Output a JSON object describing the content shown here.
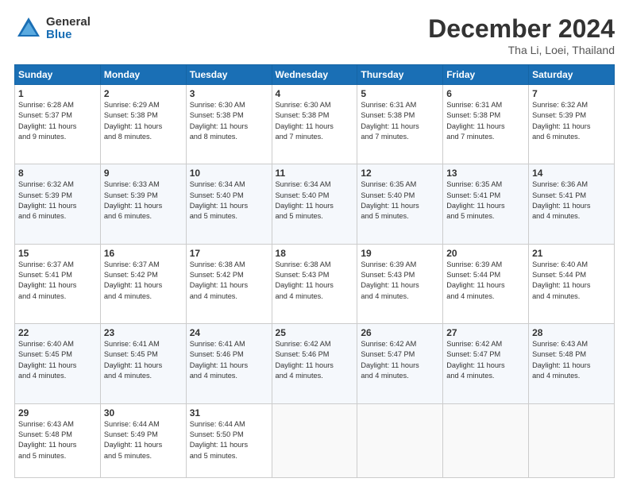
{
  "header": {
    "logo_general": "General",
    "logo_blue": "Blue",
    "month": "December 2024",
    "location": "Tha Li, Loei, Thailand"
  },
  "weekdays": [
    "Sunday",
    "Monday",
    "Tuesday",
    "Wednesday",
    "Thursday",
    "Friday",
    "Saturday"
  ],
  "weeks": [
    [
      {
        "day": "1",
        "info": "Sunrise: 6:28 AM\nSunset: 5:37 PM\nDaylight: 11 hours\nand 9 minutes."
      },
      {
        "day": "2",
        "info": "Sunrise: 6:29 AM\nSunset: 5:38 PM\nDaylight: 11 hours\nand 8 minutes."
      },
      {
        "day": "3",
        "info": "Sunrise: 6:30 AM\nSunset: 5:38 PM\nDaylight: 11 hours\nand 8 minutes."
      },
      {
        "day": "4",
        "info": "Sunrise: 6:30 AM\nSunset: 5:38 PM\nDaylight: 11 hours\nand 7 minutes."
      },
      {
        "day": "5",
        "info": "Sunrise: 6:31 AM\nSunset: 5:38 PM\nDaylight: 11 hours\nand 7 minutes."
      },
      {
        "day": "6",
        "info": "Sunrise: 6:31 AM\nSunset: 5:38 PM\nDaylight: 11 hours\nand 7 minutes."
      },
      {
        "day": "7",
        "info": "Sunrise: 6:32 AM\nSunset: 5:39 PM\nDaylight: 11 hours\nand 6 minutes."
      }
    ],
    [
      {
        "day": "8",
        "info": "Sunrise: 6:32 AM\nSunset: 5:39 PM\nDaylight: 11 hours\nand 6 minutes."
      },
      {
        "day": "9",
        "info": "Sunrise: 6:33 AM\nSunset: 5:39 PM\nDaylight: 11 hours\nand 6 minutes."
      },
      {
        "day": "10",
        "info": "Sunrise: 6:34 AM\nSunset: 5:40 PM\nDaylight: 11 hours\nand 5 minutes."
      },
      {
        "day": "11",
        "info": "Sunrise: 6:34 AM\nSunset: 5:40 PM\nDaylight: 11 hours\nand 5 minutes."
      },
      {
        "day": "12",
        "info": "Sunrise: 6:35 AM\nSunset: 5:40 PM\nDaylight: 11 hours\nand 5 minutes."
      },
      {
        "day": "13",
        "info": "Sunrise: 6:35 AM\nSunset: 5:41 PM\nDaylight: 11 hours\nand 5 minutes."
      },
      {
        "day": "14",
        "info": "Sunrise: 6:36 AM\nSunset: 5:41 PM\nDaylight: 11 hours\nand 4 minutes."
      }
    ],
    [
      {
        "day": "15",
        "info": "Sunrise: 6:37 AM\nSunset: 5:41 PM\nDaylight: 11 hours\nand 4 minutes."
      },
      {
        "day": "16",
        "info": "Sunrise: 6:37 AM\nSunset: 5:42 PM\nDaylight: 11 hours\nand 4 minutes."
      },
      {
        "day": "17",
        "info": "Sunrise: 6:38 AM\nSunset: 5:42 PM\nDaylight: 11 hours\nand 4 minutes."
      },
      {
        "day": "18",
        "info": "Sunrise: 6:38 AM\nSunset: 5:43 PM\nDaylight: 11 hours\nand 4 minutes."
      },
      {
        "day": "19",
        "info": "Sunrise: 6:39 AM\nSunset: 5:43 PM\nDaylight: 11 hours\nand 4 minutes."
      },
      {
        "day": "20",
        "info": "Sunrise: 6:39 AM\nSunset: 5:44 PM\nDaylight: 11 hours\nand 4 minutes."
      },
      {
        "day": "21",
        "info": "Sunrise: 6:40 AM\nSunset: 5:44 PM\nDaylight: 11 hours\nand 4 minutes."
      }
    ],
    [
      {
        "day": "22",
        "info": "Sunrise: 6:40 AM\nSunset: 5:45 PM\nDaylight: 11 hours\nand 4 minutes."
      },
      {
        "day": "23",
        "info": "Sunrise: 6:41 AM\nSunset: 5:45 PM\nDaylight: 11 hours\nand 4 minutes."
      },
      {
        "day": "24",
        "info": "Sunrise: 6:41 AM\nSunset: 5:46 PM\nDaylight: 11 hours\nand 4 minutes."
      },
      {
        "day": "25",
        "info": "Sunrise: 6:42 AM\nSunset: 5:46 PM\nDaylight: 11 hours\nand 4 minutes."
      },
      {
        "day": "26",
        "info": "Sunrise: 6:42 AM\nSunset: 5:47 PM\nDaylight: 11 hours\nand 4 minutes."
      },
      {
        "day": "27",
        "info": "Sunrise: 6:42 AM\nSunset: 5:47 PM\nDaylight: 11 hours\nand 4 minutes."
      },
      {
        "day": "28",
        "info": "Sunrise: 6:43 AM\nSunset: 5:48 PM\nDaylight: 11 hours\nand 4 minutes."
      }
    ],
    [
      {
        "day": "29",
        "info": "Sunrise: 6:43 AM\nSunset: 5:48 PM\nDaylight: 11 hours\nand 5 minutes."
      },
      {
        "day": "30",
        "info": "Sunrise: 6:44 AM\nSunset: 5:49 PM\nDaylight: 11 hours\nand 5 minutes."
      },
      {
        "day": "31",
        "info": "Sunrise: 6:44 AM\nSunset: 5:50 PM\nDaylight: 11 hours\nand 5 minutes."
      },
      null,
      null,
      null,
      null
    ]
  ]
}
